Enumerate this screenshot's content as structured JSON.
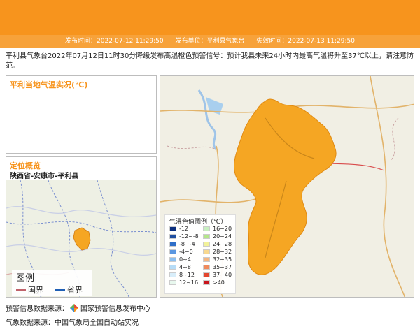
{
  "info_bar": {
    "publish_time_label": "发布时间：",
    "publish_time": "2022-07-12 11:29:50",
    "issuer_label": "发布单位：",
    "issuer": "平利县气象台",
    "expire_label": "失效时间：",
    "expire_time": "2022-07-13 11:29:50"
  },
  "notice_text": "平利县气象台2022年07月12日11时30分降级发布高温橙色预警信号：预计我县未来24小时内最高气温将升至37℃以上，请注意防范。",
  "temp_panel": {
    "title": "平利当地气温实况(℃)"
  },
  "location_panel": {
    "title": "定位概览",
    "path": "陕西省-安康市-平利县",
    "legend": {
      "title": "图例",
      "items": [
        {
          "label": "国界",
          "color": "#c0626a"
        },
        {
          "label": "省界",
          "color": "#1f5fb5"
        }
      ]
    }
  },
  "temp_legend": {
    "title": "气温色值图例（℃）",
    "items": [
      {
        "label": "-12",
        "color": "#0b2f7e"
      },
      {
        "label": "16~20",
        "color": "#c8f0c0"
      },
      {
        "label": "-12~-8",
        "color": "#1f4fa0"
      },
      {
        "label": "20~24",
        "color": "#b4e68a"
      },
      {
        "label": "-8~-4",
        "color": "#2f6fc8"
      },
      {
        "label": "24~28",
        "color": "#f2f29a"
      },
      {
        "label": "-4~0",
        "color": "#5b97e0"
      },
      {
        "label": "28~32",
        "color": "#f8d98f"
      },
      {
        "label": "0~4",
        "color": "#8cc0f0"
      },
      {
        "label": "32~35",
        "color": "#f5b681"
      },
      {
        "label": "4~8",
        "color": "#b6dcf6"
      },
      {
        "label": "35~37",
        "color": "#f08a5c"
      },
      {
        "label": "8~12",
        "color": "#d8eefa"
      },
      {
        "label": "37~40",
        "color": "#e4462e"
      },
      {
        "label": "12~16",
        "color": "#e8f8ee"
      },
      {
        "label": ">40",
        "color": "#c8141c"
      }
    ]
  },
  "footer": {
    "warning_source_label": "预警信息数据来源：",
    "warning_source": "国家预警信息发布中心",
    "weather_source_label": "气象数据来源：",
    "weather_source": "中国气象局全国自动站实况"
  },
  "colors": {
    "header": "#f7941d",
    "info_bar": "#f7a23a",
    "warning_region": "#f5a623"
  }
}
